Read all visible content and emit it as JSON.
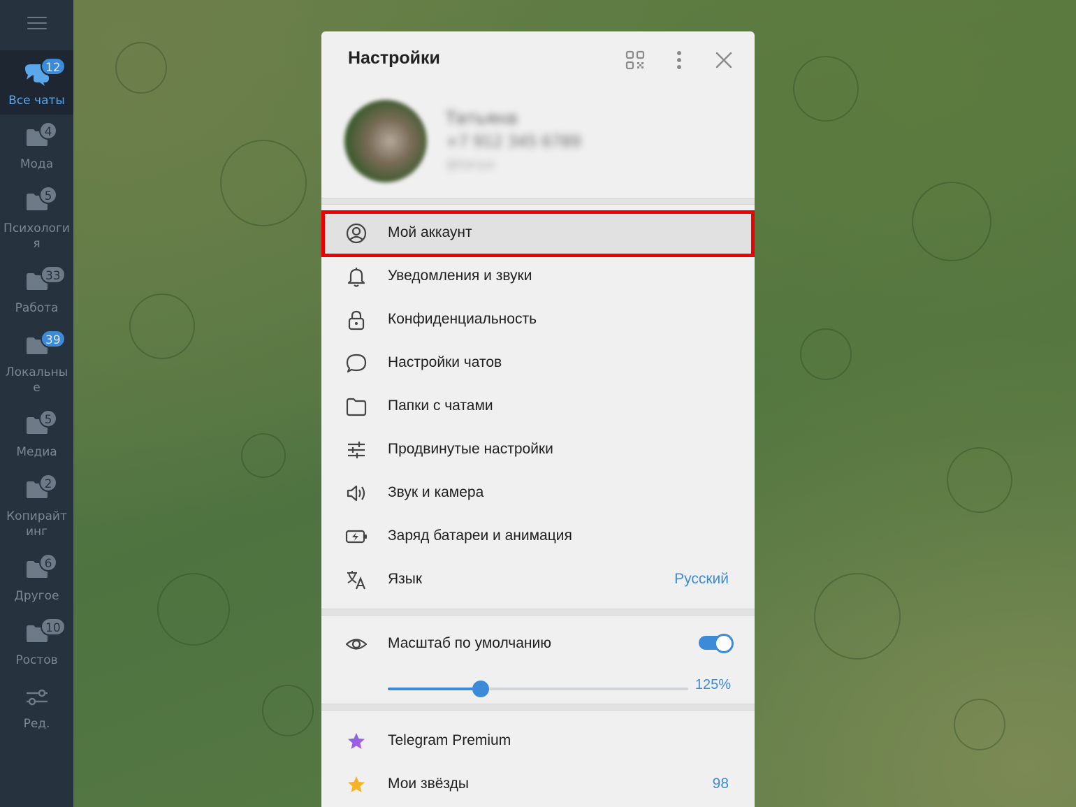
{
  "sidebar": {
    "folders": [
      {
        "label": "Все чаты",
        "badge": "12",
        "active": true
      },
      {
        "label": "Мода",
        "badge": "4"
      },
      {
        "label": "Психологи\nя",
        "badge": "5"
      },
      {
        "label": "Работа",
        "badge": "33"
      },
      {
        "label": "Локальны\nе",
        "badge": "39"
      },
      {
        "label": "Медиа",
        "badge": "5"
      },
      {
        "label": "Копирайт\nинг",
        "badge": "2"
      },
      {
        "label": "Другое",
        "badge": "6"
      },
      {
        "label": "Ростов",
        "badge": "10"
      },
      {
        "label": "Ред."
      }
    ]
  },
  "panel": {
    "title": "Настройки",
    "profile": {
      "name": "Татьяна",
      "phone": "+7 912 345 6789",
      "username": "@tanya"
    },
    "items": [
      {
        "label": "Мой аккаунт",
        "icon": "account-icon"
      },
      {
        "label": "Уведомления и звуки",
        "icon": "bell-icon"
      },
      {
        "label": "Конфиденциальность",
        "icon": "lock-icon"
      },
      {
        "label": "Настройки чатов",
        "icon": "chat-bubble-icon"
      },
      {
        "label": "Папки с чатами",
        "icon": "folder-icon"
      },
      {
        "label": "Продвинутые настройки",
        "icon": "sliders-icon"
      },
      {
        "label": "Звук и камера",
        "icon": "speaker-icon"
      },
      {
        "label": "Заряд батареи и анимация",
        "icon": "battery-icon"
      },
      {
        "label": "Язык",
        "icon": "translate-icon",
        "value": "Русский"
      }
    ],
    "scale": {
      "label": "Масштаб по умолчанию",
      "enabled": true,
      "value_text": "125%",
      "slider_fraction": 0.31
    },
    "premium": [
      {
        "label": "Telegram Premium",
        "icon": "premium-star-icon"
      },
      {
        "label": "Мои звёзды",
        "icon": "gold-star-icon",
        "value": "98"
      }
    ]
  },
  "colors": {
    "accent": "#3d8bd8",
    "highlight_frame": "#ef0000",
    "sidebar_bg": "#26323e"
  }
}
